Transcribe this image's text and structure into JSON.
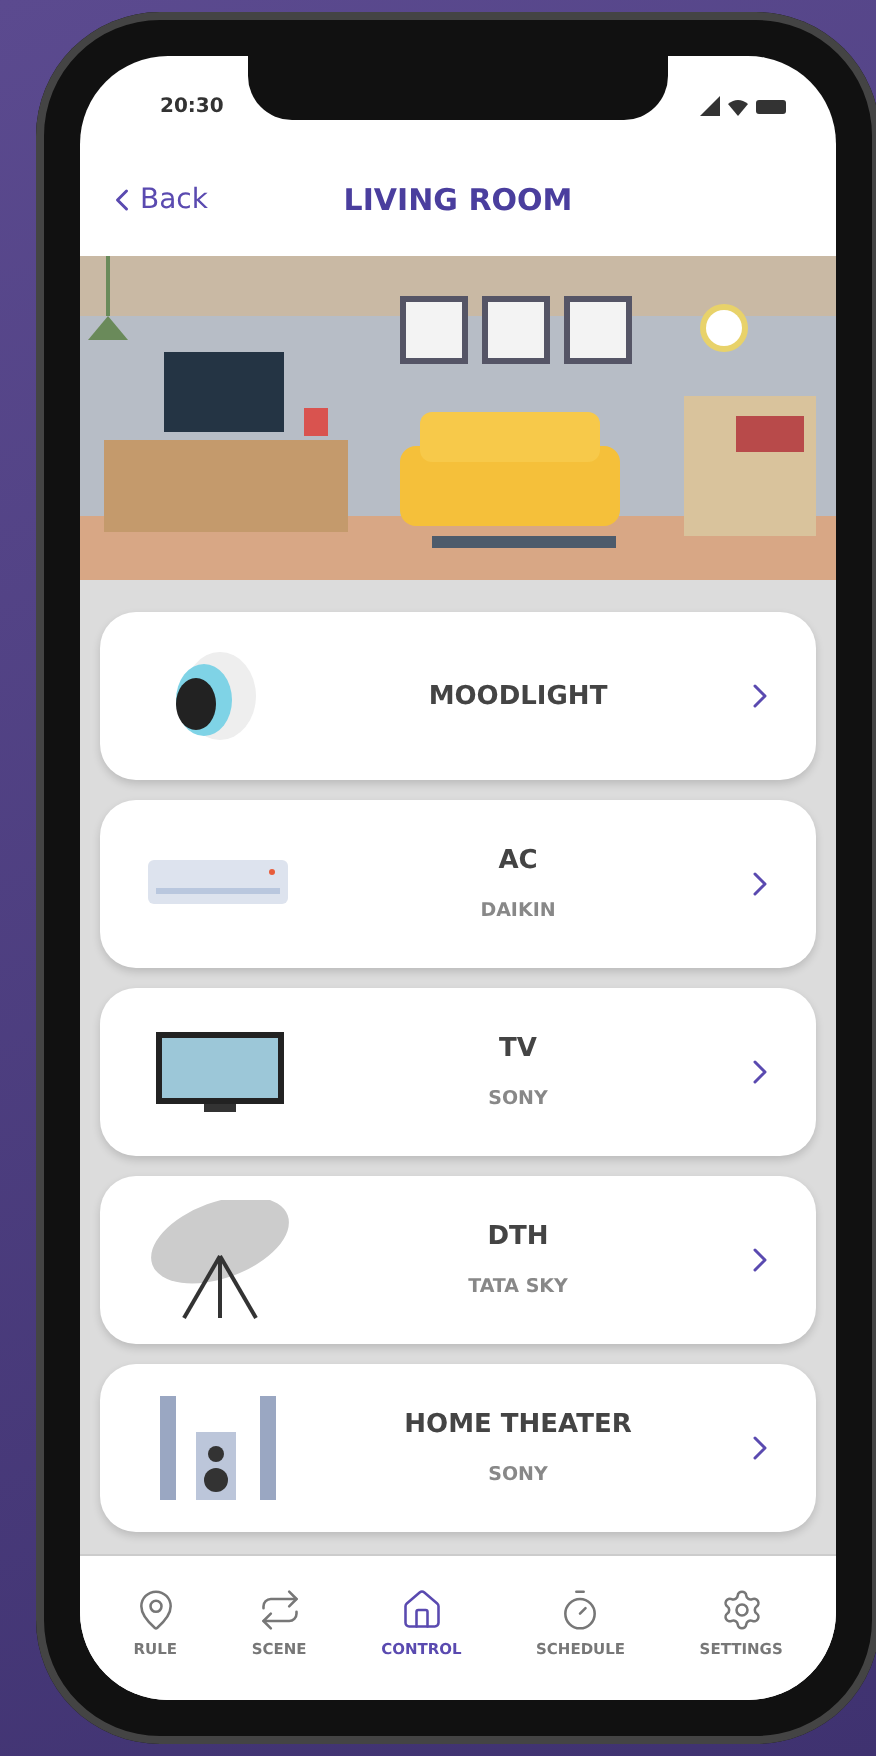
{
  "status_bar": {
    "time": "20:30"
  },
  "nav": {
    "back": "Back",
    "title": "LIVING ROOM"
  },
  "devices": [
    {
      "kind": "light",
      "name": "MOODLIGHT"
    },
    {
      "kind": "ac",
      "name": "AC",
      "brand": "DAIKIN"
    },
    {
      "kind": "tv",
      "name": "TV",
      "brand": "SONY"
    },
    {
      "kind": "dish",
      "name": "DTH",
      "brand": "TATA SKY"
    },
    {
      "kind": "speaker",
      "name": "HOME THEATER",
      "brand": "SONY"
    }
  ],
  "tabs": [
    {
      "kind": "rule",
      "label": "RULE",
      "selected": false
    },
    {
      "kind": "scene",
      "label": "SCENE",
      "selected": false
    },
    {
      "kind": "control",
      "label": "CONTROL",
      "selected": true
    },
    {
      "kind": "schedule",
      "label": "SCHEDULE",
      "selected": false
    },
    {
      "kind": "settings",
      "label": "SETTINGS",
      "selected": false
    }
  ]
}
